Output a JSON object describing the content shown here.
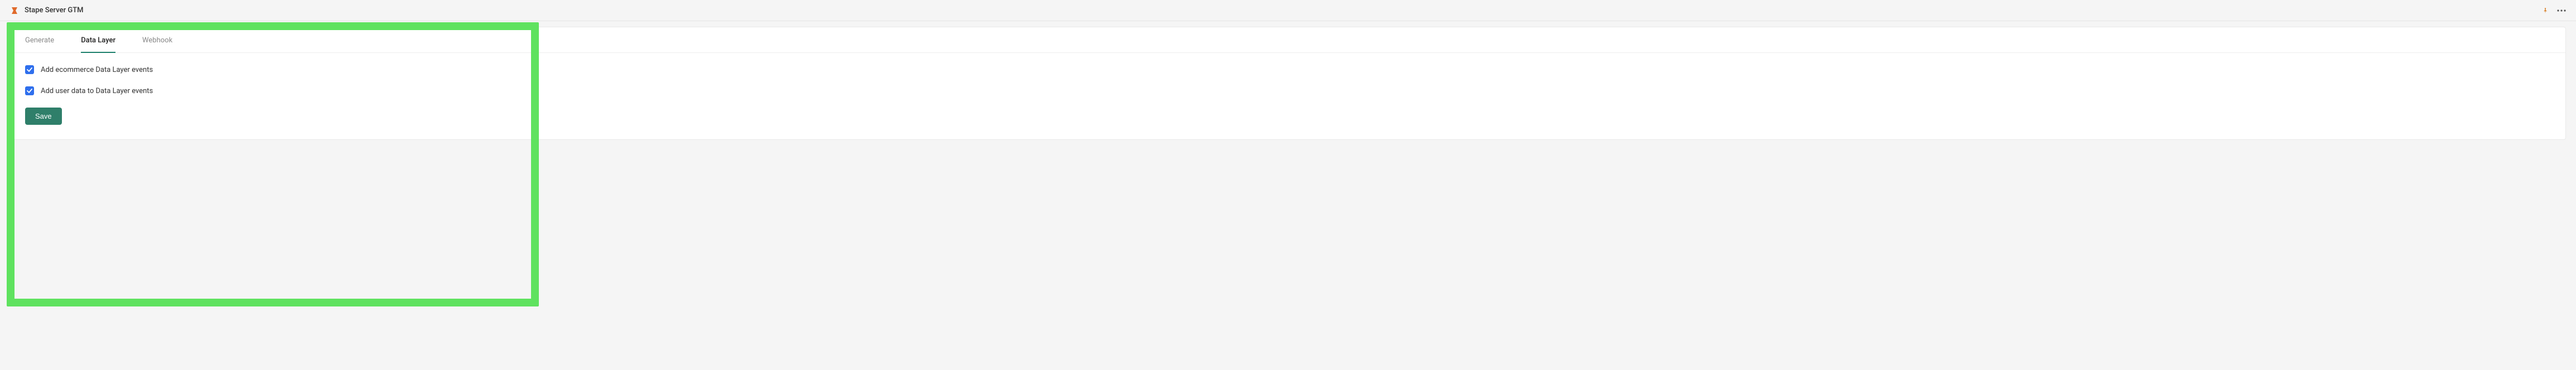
{
  "header": {
    "title": "Stape Server GTM"
  },
  "tabs": {
    "generate": "Generate",
    "data_layer": "Data Layer",
    "webhook": "Webhook",
    "active": "data_layer"
  },
  "options": {
    "ecommerce_label": "Add ecommerce Data Layer events",
    "ecommerce_checked": true,
    "userdata_label": "Add user data to Data Layer events",
    "userdata_checked": true
  },
  "buttons": {
    "save": "Save"
  },
  "colors": {
    "accent_green": "#2f7f6a",
    "checkbox_blue": "#2f6fed",
    "highlight_green": "#5fe25f"
  }
}
